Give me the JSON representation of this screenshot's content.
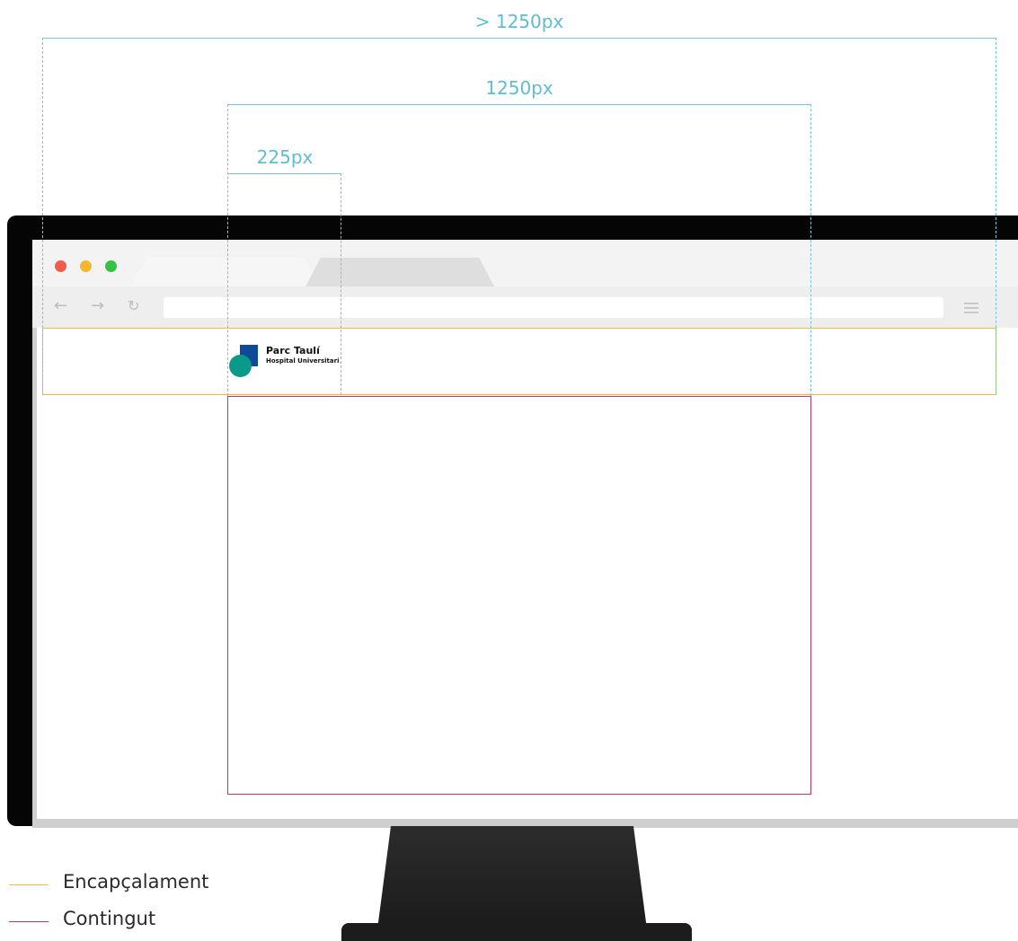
{
  "dimensions": {
    "outer_label": "> 1250px",
    "container_label": "1250px",
    "logo_width_label": "225px"
  },
  "logo": {
    "title": "Parc Taulí",
    "subtitle": "Hospital Universitari",
    "colors": {
      "blue": "#0f4a96",
      "green": "#0b9a8a"
    }
  },
  "legend": [
    {
      "label": "Encapçalament",
      "color": "#f4b93a"
    },
    {
      "label": "Contingut",
      "color": "#c4385f"
    }
  ],
  "browser": {
    "traffic_lights": [
      "#f25a4a",
      "#f5b731",
      "#34c243"
    ],
    "icons": [
      "back-arrow-icon",
      "forward-arrow-icon",
      "reload-icon",
      "menu-icon"
    ]
  },
  "colors": {
    "guide": "#78c3d6"
  }
}
